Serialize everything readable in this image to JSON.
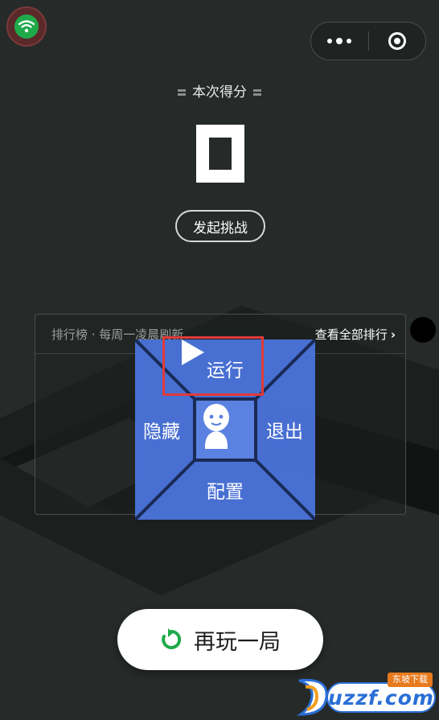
{
  "header": {
    "wifi_icon": "wifi-icon",
    "capsule": {
      "more_icon": "more-dots-icon",
      "close_icon": "close-target-icon"
    }
  },
  "score": {
    "title": "本次得分",
    "value": "0"
  },
  "challenge": {
    "label": "发起挑战"
  },
  "ranking": {
    "title": "排行榜 · 每周一凌晨刷新",
    "view_all": "查看全部排行",
    "chevron": "›"
  },
  "overlay_menu": {
    "run": "运行",
    "hide": "隐藏",
    "exit": "退出",
    "config": "配置",
    "center_icon": "robot-avatar-icon",
    "color": "#4a72d8"
  },
  "play_again": {
    "label": "再玩一局",
    "icon": "replay-icon",
    "accent": "#1faa4a"
  },
  "watermark": {
    "text": "uzzf.com",
    "tag": "东坡下载"
  }
}
